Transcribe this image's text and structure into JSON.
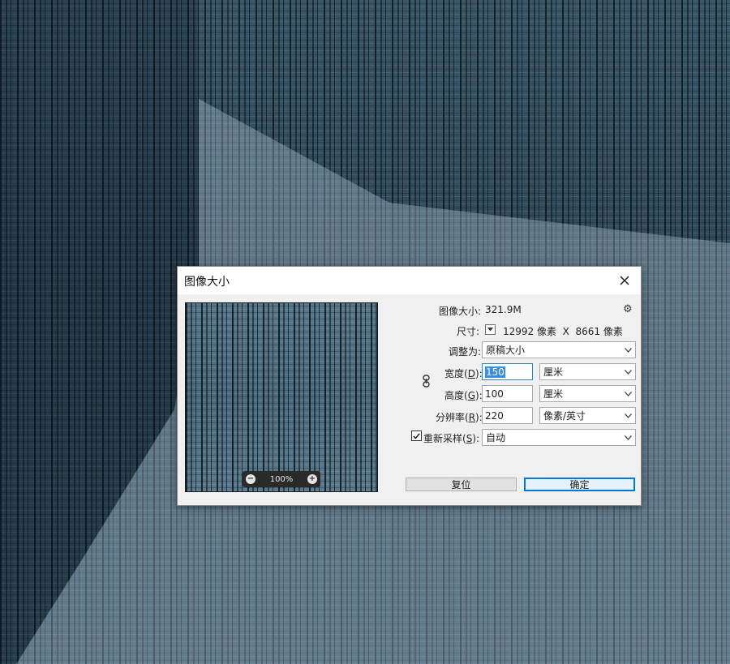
{
  "dialog": {
    "title": "图像大小",
    "image_size_label": "图像大小:",
    "image_size_value": "321.9M",
    "dimensions_label": "尺寸:",
    "dimensions_value": "12992 像素  X  8661 像素",
    "fit_to_label": "调整为:",
    "fit_to_value": "原稿大小",
    "width_label": "宽度(",
    "width_key": "D",
    "width_label_end": "):",
    "width_value": "150",
    "width_unit": "厘米",
    "height_label": "高度(",
    "height_key": "G",
    "height_label_end": "):",
    "height_value": "100",
    "height_unit": "厘米",
    "resolution_label": "分辨率(",
    "resolution_key": "R",
    "resolution_label_end": "):",
    "resolution_value": "220",
    "resolution_unit": "像素/英寸",
    "resample_label": "重新采样(",
    "resample_key": "S",
    "resample_label_end": "):",
    "resample_checked": true,
    "resample_value": "自动",
    "reset_button": "复位",
    "ok_button": "确定"
  },
  "preview": {
    "zoom": "100%"
  },
  "icons": [
    "close-icon",
    "gear-icon",
    "chevron-down-icon",
    "link-icon",
    "zoom-out-icon",
    "zoom-in-icon",
    "checkmark-icon"
  ],
  "colors": {
    "accent": "#0078d7",
    "selection": "#3a8ee6"
  }
}
